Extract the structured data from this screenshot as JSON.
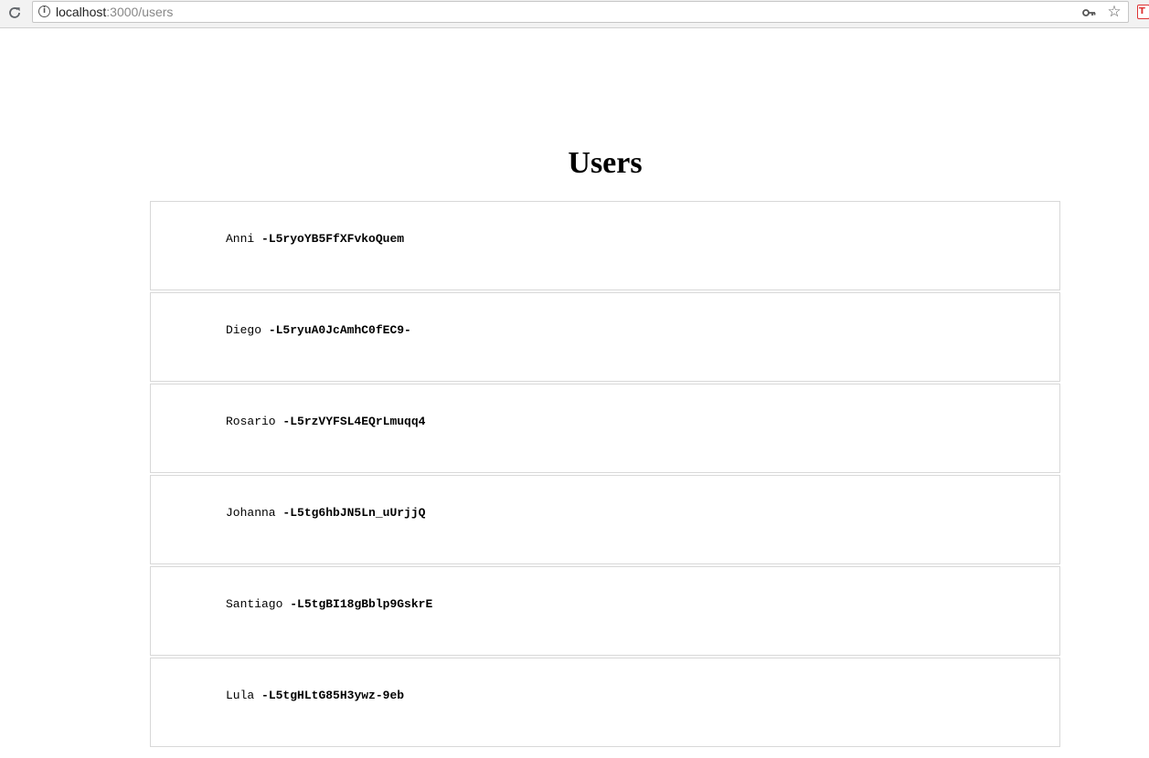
{
  "browser": {
    "url_host": "localhost",
    "url_path": ":3000/users",
    "icons": {
      "reload": "reload-icon",
      "info": "info-icon",
      "key": "key-icon",
      "star": "star-icon",
      "extension": "extension-icon"
    },
    "extension_letter": "T"
  },
  "page": {
    "title": "Users",
    "users": [
      {
        "name": "Anni",
        "id": "-L5ryoYB5FfXFvkoQuem"
      },
      {
        "name": "Diego",
        "id": "-L5ryuA0JcAmhC0fEC9-"
      },
      {
        "name": "Rosario",
        "id": "-L5rzVYFSL4EQrLmuqq4"
      },
      {
        "name": "Johanna",
        "id": "-L5tg6hbJN5Ln_uUrjjQ"
      },
      {
        "name": "Santiago",
        "id": "-L5tgBI18gBblp9GskrE"
      },
      {
        "name": "Lula",
        "id": "-L5tgHLtG85H3ywz-9eb"
      }
    ]
  }
}
